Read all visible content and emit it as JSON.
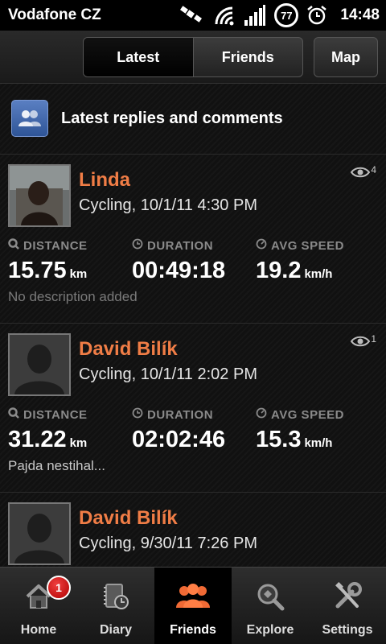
{
  "status_bar": {
    "carrier": "Vodafone CZ",
    "battery": "77",
    "time": "14:48",
    "icons": [
      "satellite-icon",
      "wifi-icon",
      "signal-icon",
      "battery-icon",
      "alarm-icon"
    ]
  },
  "top_tabs": {
    "latest": "Latest",
    "friends": "Friends",
    "map": "Map",
    "active": "Latest"
  },
  "section": {
    "title": "Latest replies and comments",
    "icon": "friends-group-icon"
  },
  "stat_labels": {
    "distance": "DISTANCE",
    "duration": "DURATION",
    "avg_speed": "AVG SPEED"
  },
  "entries": [
    {
      "name": "Linda",
      "activity": "Cycling, 10/1/11 4:30 PM",
      "views": "4",
      "distance": "15.75",
      "distance_unit": "km",
      "duration": "00:49:18",
      "avg_speed": "19.2",
      "speed_unit": "km/h",
      "description": "No description added"
    },
    {
      "name": "David Bilík",
      "activity": "Cycling, 10/1/11 2:02 PM",
      "views": "1",
      "distance": "31.22",
      "distance_unit": "km",
      "duration": "02:02:46",
      "avg_speed": "15.3",
      "speed_unit": "km/h",
      "description": "Pajda nestihal..."
    },
    {
      "name": "David Bilík",
      "activity": "Cycling, 9/30/11 7:26 PM"
    }
  ],
  "bottom_nav": {
    "home": "Home",
    "home_badge": "1",
    "diary": "Diary",
    "friends": "Friends",
    "explore": "Explore",
    "settings": "Settings",
    "active": "Friends"
  },
  "colors": {
    "accent": "#f07d46",
    "background": "#111111",
    "badge": "#d01010"
  }
}
